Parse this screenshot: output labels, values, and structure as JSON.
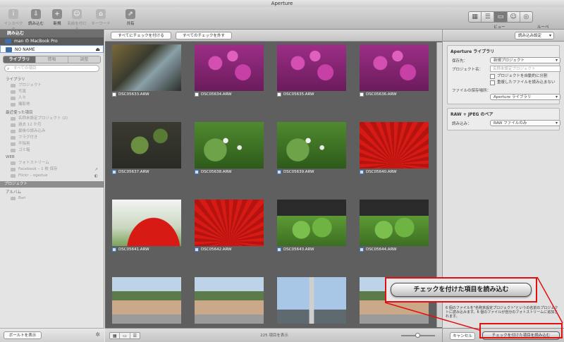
{
  "window": {
    "title": "Aperture"
  },
  "toolbar": {
    "tools": [
      {
        "label": "インスペクタ",
        "icon": "info-icon",
        "glyph": "i",
        "dim": true
      },
      {
        "label": "読み込む",
        "icon": "import-icon",
        "glyph": "⇩",
        "dim": false
      },
      {
        "label": "新規",
        "icon": "new-icon",
        "glyph": "+",
        "dim": false
      },
      {
        "label": "名前を付ける",
        "icon": "name-icon",
        "glyph": "☺",
        "dim": true
      },
      {
        "label": "キーワード",
        "icon": "keyword-icon",
        "glyph": "⌂",
        "dim": true
      },
      {
        "label": "共有",
        "icon": "share-icon",
        "glyph": "⇗",
        "dim": false
      }
    ],
    "view_label": "ビュー",
    "zoom_label": "ルーペ"
  },
  "sidebar": {
    "header": "読み込む",
    "devices": [
      {
        "name": "man の MacBook Pro"
      },
      {
        "name": "NO NAME"
      }
    ],
    "tabs": [
      "ライブラリ",
      "情報",
      "調整"
    ],
    "search_placeholder": "すべての項目",
    "library_title": "ライブラリ",
    "library_items": [
      "プロジェクト",
      "写真",
      "人々",
      "撮影地"
    ],
    "recent_title": "最近使った項目",
    "recent_items": [
      "名称未設定プロジェクト (2)",
      "過去 12 か月",
      "最後の読み込み",
      "フラグ付き",
      "不採用",
      "ゴミ箱"
    ],
    "web_title": "WEB",
    "web_items": [
      "フォトストリーム",
      "Facebook – 1 枚 保存",
      "Flickr – ogedue"
    ],
    "project_bar": "プロジェクト",
    "album_title": "アルバム",
    "album_items": [
      "Ban"
    ],
    "show_portal_button": "ボールトを表示"
  },
  "center": {
    "check_all": "すべてにチェックを付ける",
    "uncheck_all": "すべてのチェックを外す",
    "photos": [
      {
        "name": "DSC05633.ARW",
        "palette": "water"
      },
      {
        "name": "DSC05634.ARW",
        "palette": "pink"
      },
      {
        "name": "DSC05635.ARW",
        "palette": "pink"
      },
      {
        "name": "DSC05636.ARW",
        "palette": "pink"
      },
      {
        "name": "DSC05637.ARW",
        "palette": "clover"
      },
      {
        "name": "DSC05638.ARW",
        "palette": "greenflower"
      },
      {
        "name": "DSC05639.ARW",
        "palette": "greenflower"
      },
      {
        "name": "DSC05640.ARW",
        "palette": "umbrella"
      },
      {
        "name": "DSC05641.ARW",
        "palette": "umbrellasky"
      },
      {
        "name": "DSC05642.ARW",
        "palette": "umbrella"
      },
      {
        "name": "DSC05643.ARW",
        "palette": "leaves"
      },
      {
        "name": "DSC05644.ARW",
        "palette": "leaves"
      },
      {
        "name": "",
        "palette": "street"
      },
      {
        "name": "",
        "palette": "street"
      },
      {
        "name": "",
        "palette": "tower"
      },
      {
        "name": "",
        "palette": "street"
      }
    ],
    "count_text": "225 項目を表示"
  },
  "rpanel": {
    "preset_select": "読み込み設定",
    "library_section": "Aperture ライブラリ",
    "dest_label": "保存先：",
    "dest_value": "新規プロジェクト",
    "project_name_label": "プロジェクト名：",
    "project_name_placeholder": "名称未設定プロジェクト",
    "auto_split": "プロジェクトを自動的に分割",
    "dont_import_dupes": "重複したファイルを読み込まない",
    "store_label": "ファイルの保存場所：",
    "store_value": "Aperture ライブラリ",
    "raw_section": "RAW + JPEG のペア",
    "raw_import_label": "読み込み：",
    "raw_import_value": "RAW ファイルのみ",
    "note": "6 個のファイルを\"名称未設定プロジェクト\"というの名前のプロジェクトに読み込みます。6 個のファイルが自分のフォトストリームに追加されます。",
    "cancel": "キャンセル",
    "import_checked": "チェックを付けた項目を読み込む"
  },
  "callout": {
    "label": "チェックを付けた項目を読み込む"
  },
  "colors": {
    "highlight": "#e01010"
  }
}
